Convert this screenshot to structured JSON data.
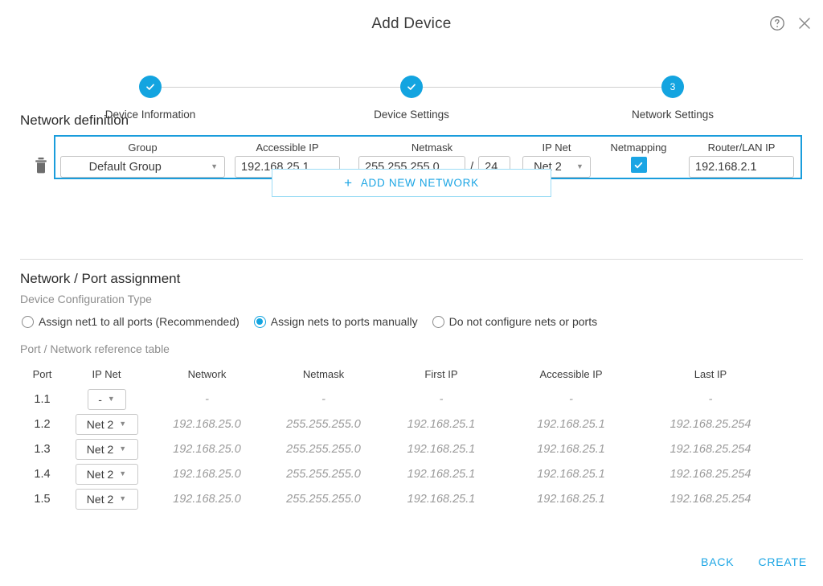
{
  "dialog": {
    "title": "Add Device",
    "help_icon": "help-circle-icon",
    "close_icon": "close-icon"
  },
  "stepper": {
    "steps": [
      {
        "label": "Device Information",
        "state": "complete",
        "marker": "✓"
      },
      {
        "label": "Device Settings",
        "state": "complete",
        "marker": "✓"
      },
      {
        "label": "Network Settings",
        "state": "active",
        "marker": "3"
      }
    ],
    "accent_color": "#13a4e0"
  },
  "network_definition": {
    "title": "Network definition",
    "delete_icon": "trash-icon",
    "columns": {
      "group": "Group",
      "accessible_ip": "Accessible IP",
      "netmask": "Netmask",
      "ip_net": "IP Net",
      "netmapping": "Netmapping",
      "router_lan_ip": "Router/LAN IP"
    },
    "row": {
      "group": "Default Group",
      "accessible_ip": "192.168.25.1",
      "netmask": "255.255.255.0",
      "prefix_separator": "/",
      "prefix": "24",
      "ip_net": "Net 2",
      "netmapping_checked": true,
      "netmapping_glyph": "✓",
      "router_lan_ip": "192.168.2.1"
    },
    "add_network_label": "ADD NEW NETWORK",
    "add_network_icon": "plus-icon",
    "highlight_color": "#1a9ddc"
  },
  "port_assignment": {
    "title": "Network / Port assignment",
    "config_type_label": "Device Configuration Type",
    "options": [
      {
        "label": "Assign net1 to all ports (Recommended)",
        "selected": false
      },
      {
        "label": "Assign nets to ports manually",
        "selected": true
      },
      {
        "label": "Do not configure nets or ports",
        "selected": false
      }
    ],
    "table_caption": "Port / Network reference table",
    "headers": [
      "Port",
      "IP Net",
      "Network",
      "Netmask",
      "First IP",
      "Accessible IP",
      "Last IP"
    ],
    "rows": [
      {
        "port": "1.1",
        "ip_net": "-",
        "network": "-",
        "netmask": "-",
        "first_ip": "-",
        "accessible_ip": "-",
        "last_ip": "-"
      },
      {
        "port": "1.2",
        "ip_net": "Net 2",
        "network": "192.168.25.0",
        "netmask": "255.255.255.0",
        "first_ip": "192.168.25.1",
        "accessible_ip": "192.168.25.1",
        "last_ip": "192.168.25.254"
      },
      {
        "port": "1.3",
        "ip_net": "Net 2",
        "network": "192.168.25.0",
        "netmask": "255.255.255.0",
        "first_ip": "192.168.25.1",
        "accessible_ip": "192.168.25.1",
        "last_ip": "192.168.25.254"
      },
      {
        "port": "1.4",
        "ip_net": "Net 2",
        "network": "192.168.25.0",
        "netmask": "255.255.255.0",
        "first_ip": "192.168.25.1",
        "accessible_ip": "192.168.25.1",
        "last_ip": "192.168.25.254"
      },
      {
        "port": "1.5",
        "ip_net": "Net 2",
        "network": "192.168.25.0",
        "netmask": "255.255.255.0",
        "first_ip": "192.168.25.1",
        "accessible_ip": "192.168.25.1",
        "last_ip": "192.168.25.254"
      }
    ]
  },
  "footer": {
    "back_label": "BACK",
    "create_label": "CREATE",
    "link_color": "#1ba5e4"
  }
}
